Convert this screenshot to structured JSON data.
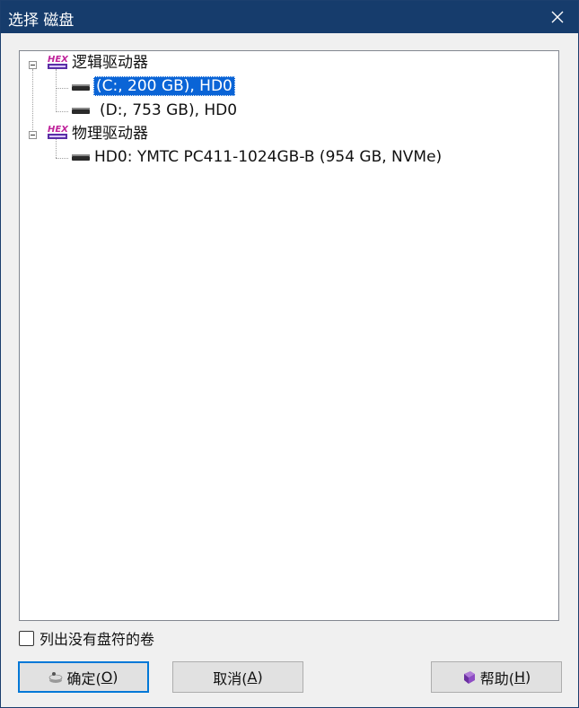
{
  "window": {
    "title": "选择 磁盘",
    "close_icon": "close-icon"
  },
  "tree": {
    "groups": [
      {
        "label": "逻辑驱动器",
        "icon": "hex-editor-icon",
        "items": [
          {
            "label": "(C:, 200 GB), HD0",
            "icon": "drive-icon",
            "selected": true
          },
          {
            "label": "(D:, 753 GB), HD0",
            "icon": "drive-icon",
            "selected": false
          }
        ]
      },
      {
        "label": "物理驱动器",
        "icon": "hex-editor-icon",
        "items": [
          {
            "label": "HD0: YMTC PC411-1024GB-B (954 GB, NVMe)",
            "icon": "drive-icon",
            "selected": false
          }
        ]
      }
    ]
  },
  "options": {
    "list_volumes_label": "列出没有盘符的卷",
    "list_volumes_checked": false
  },
  "buttons": {
    "ok": {
      "pre": "确定(",
      "key": "O",
      "post": ")",
      "icon": "disk-icon"
    },
    "cancel": {
      "pre": "取消(",
      "key": "A",
      "post": ")"
    },
    "help": {
      "pre": "帮助(",
      "key": "H",
      "post": ")",
      "icon": "help-book-icon"
    }
  },
  "colors": {
    "titlebar": "#163c6c",
    "selection": "#0a64d6",
    "default_button_border": "#0078d7"
  }
}
